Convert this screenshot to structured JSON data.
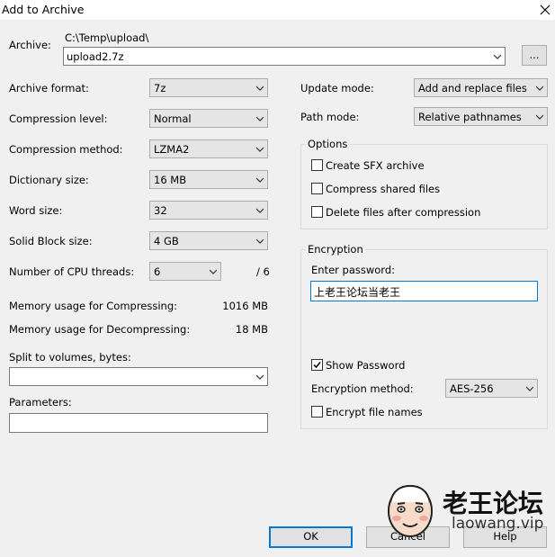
{
  "window": {
    "title": "Add to Archive"
  },
  "archive": {
    "label": "Archive:",
    "path": "C:\\Temp\\upload\\",
    "name": "upload2.7z",
    "browse_label": "..."
  },
  "left": {
    "archive_format": {
      "label": "Archive format:",
      "value": "7z"
    },
    "compression_level": {
      "label": "Compression level:",
      "value": "Normal"
    },
    "compression_method": {
      "label": "Compression method:",
      "value": "LZMA2"
    },
    "dictionary_size": {
      "label": "Dictionary size:",
      "value": "16 MB"
    },
    "word_size": {
      "label": "Word size:",
      "value": "32"
    },
    "solid_block_size": {
      "label": "Solid Block size:",
      "value": "4 GB"
    },
    "cpu_threads": {
      "label": "Number of CPU threads:",
      "value": "6",
      "max": "/ 6"
    },
    "mem_compress": {
      "label": "Memory usage for Compressing:",
      "value": "1016 MB"
    },
    "mem_decompress": {
      "label": "Memory usage for Decompressing:",
      "value": "18 MB"
    },
    "split": {
      "label": "Split to volumes, bytes:",
      "value": ""
    },
    "parameters": {
      "label": "Parameters:",
      "value": ""
    }
  },
  "right": {
    "update_mode": {
      "label": "Update mode:",
      "value": "Add and replace files"
    },
    "path_mode": {
      "label": "Path mode:",
      "value": "Relative pathnames"
    },
    "options": {
      "title": "Options",
      "create_sfx": {
        "label": "Create SFX archive",
        "checked": false
      },
      "compress_shared": {
        "label": "Compress shared files",
        "checked": false
      },
      "delete_after": {
        "label": "Delete files after compression",
        "checked": false
      }
    },
    "encryption": {
      "title": "Encryption",
      "password_label": "Enter password:",
      "password_value": "上老王论坛当老王",
      "show_password": {
        "label": "Show Password",
        "checked": true
      },
      "method_label": "Encryption method:",
      "method_value": "AES-256",
      "encrypt_names": {
        "label": "Encrypt file names",
        "checked": false
      }
    }
  },
  "buttons": {
    "ok": "OK",
    "cancel": "Cancel",
    "help": "Help"
  },
  "watermark": {
    "text": "老王论坛",
    "url": "laowang.vip"
  }
}
